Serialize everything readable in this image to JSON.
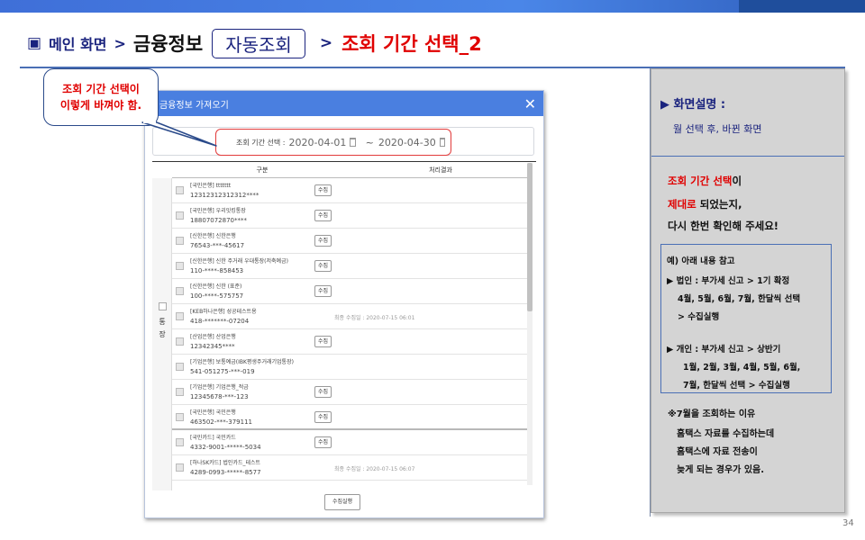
{
  "header": {
    "square_icon": "▣",
    "crumb1": "메인 화면",
    "gt1": ">",
    "crumb2": "금융정보",
    "button_label": "자동조회",
    "gt2": ">",
    "title": "조회 기간 선택_2"
  },
  "callout": {
    "line1": "조회 기간 선택이",
    "line2": "이렇게 바껴야 함."
  },
  "dialog": {
    "title": "금융정보 가져오기",
    "close": "✕",
    "period_label": "조회 기간 선택 :",
    "date_start": "2020-04-01",
    "tilde": "~",
    "date_end": "2020-04-30",
    "col_category": "구분",
    "col_result": "처리결과",
    "side_label_1": "통",
    "side_label_2": "장",
    "collect_button": "수집실행",
    "rows": [
      {
        "name": "[국민은행] ttttttt",
        "account": "12312312312312****",
        "button": "수집",
        "result": ""
      },
      {
        "name": "[국민은행] 우리잇킹통장",
        "account": "18807072870****",
        "button": "수집",
        "result": ""
      },
      {
        "name": "[신한은행] 신한은행",
        "account": "76543-***-45617",
        "button": "수집",
        "result": ""
      },
      {
        "name": "[신한은행] 신한 주거래 우대통장(저축예금)",
        "account": "110-****-858453",
        "button": "수집",
        "result": ""
      },
      {
        "name": "[신한은행] 신한 (표준)",
        "account": "100-****-575757",
        "button": "수집",
        "result": ""
      },
      {
        "name": "[KEB하나은행] 성공테스트용",
        "account": "418-*******-07204",
        "button": "",
        "result": "최종 수집일 : 2020-07-15 06:01"
      },
      {
        "name": "[산업은행] 산업은행",
        "account": "12342345****",
        "button": "수집",
        "result": ""
      },
      {
        "name": "[기업은행] 보통예금(IBK평생주거래기업통장)",
        "account": "541-051275-***-019",
        "button": "",
        "result": ""
      },
      {
        "name": "[기업은행] 기업은행_적금",
        "account": "12345678-***-123",
        "button": "수집",
        "result": ""
      },
      {
        "name": "[국민은행] 국민은행",
        "account": "463502-***-379111",
        "button": "수집",
        "result": ""
      },
      {
        "name": "[국민카드] 국민카드",
        "account": "4332-9001-*****-5034",
        "button": "수집",
        "result": ""
      },
      {
        "name": "[하나SK카드] 법인카드_테스트",
        "account": "4289-0993-*****-8577",
        "button": "",
        "result": "최종 수집일 : 2020-07-15 06:07"
      }
    ]
  },
  "panel": {
    "title": "▶ 화면설명 :",
    "subtitle": "월 선택 후, 바뀐 화면",
    "line1_red": "조회 기간 선택",
    "line1_black": "이",
    "line2_red": "제대로",
    "line2_black": " 되었는지,",
    "line3": "다시 한번 확인해 주세요!",
    "note_title": "예) 아래 내용 참고",
    "note_corp_1": "▶ 법인 : 부가세 신고 > 1기 확정",
    "note_corp_2": "4월, 5월, 6월, 7월,  한달씩 선택",
    "note_corp_3": "> 수집실행",
    "note_ind_1": "▶ 개인 : 부가세 신고 > 상반기",
    "note_ind_2": "1월, 2월, 3월, 4월, 5월, 6월,",
    "note_ind_3": "7월, 한달씩 선택 > 수집실행",
    "reason_1": "※7월을 조회하는 이유",
    "reason_2": "홈택스 자료를 수집하는데",
    "reason_3": "홈택스에 자료 전송이",
    "reason_4": "늦게 되는 경우가 있음."
  },
  "page_number": "34",
  "colors": {
    "accent_blue": "#4a7fe0",
    "title_red": "#e00000",
    "navy": "#1a237e"
  }
}
